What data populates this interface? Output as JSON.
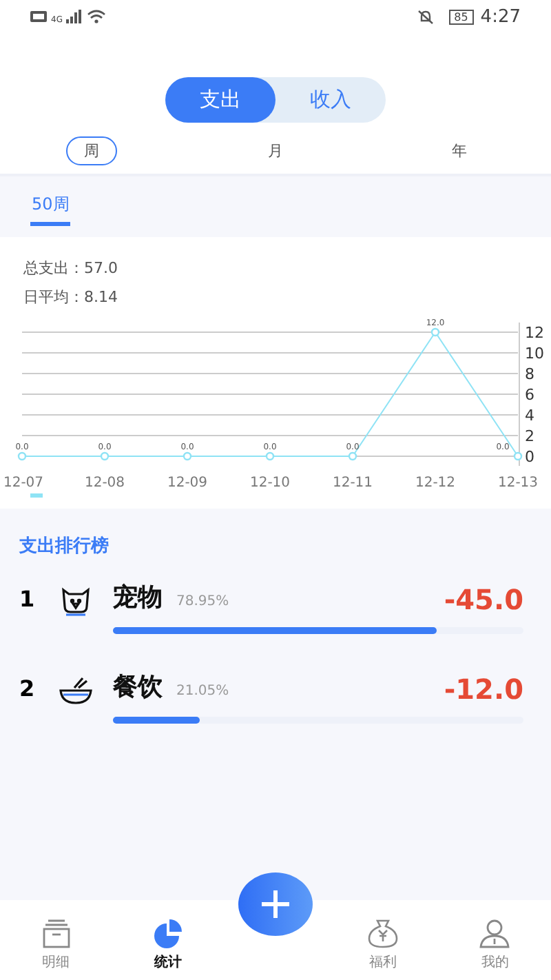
{
  "status_bar": {
    "network": "4G",
    "battery": "85",
    "time": "4:27"
  },
  "type_toggle": [
    {
      "label": "支出",
      "selected": true
    },
    {
      "label": "收入",
      "selected": false
    }
  ],
  "period_tabs": [
    {
      "label": "周",
      "selected": true
    },
    {
      "label": "月",
      "selected": false
    },
    {
      "label": "年",
      "selected": false
    }
  ],
  "week_tabs": [
    {
      "label": "50周",
      "selected": true
    }
  ],
  "summary": [
    {
      "label": "总支出：",
      "value": "57.0"
    },
    {
      "label": "日平均：",
      "value": "8.14"
    }
  ],
  "chart": {
    "chart_data": {
      "type": "line",
      "categories": [
        "12-07",
        "12-08",
        "12-09",
        "12-10",
        "12-11",
        "12-12",
        "12-13"
      ],
      "series": [
        {
          "color": "#8fe3f5",
          "values": [
            0,
            0,
            0,
            0,
            0,
            12,
            0
          ],
          "marker": "circle"
        }
      ],
      "ylim": [
        0,
        12
      ],
      "yticks": [
        0,
        2,
        4,
        6,
        8,
        10,
        12
      ],
      "grid": true,
      "value_labels": [
        "0.0",
        "0.0",
        "0.0",
        "0.0",
        "0.0",
        "12.0",
        "0.0"
      ]
    }
  },
  "ranking": {
    "title": "支出排行榜",
    "items": [
      {
        "rank": "1",
        "kind": "pet",
        "name": "宠物",
        "percent": "78.95%",
        "amount": "-45.0",
        "level": 0.7895
      },
      {
        "rank": "2",
        "kind": "food",
        "name": "餐饮",
        "percent": "21.05%",
        "amount": "-12.0",
        "level": 0.2105
      }
    ]
  },
  "nav": [
    {
      "kind": "details",
      "label": "明细",
      "selected": false
    },
    {
      "kind": "stats",
      "label": "统计",
      "selected": true
    },
    {
      "kind": "add"
    },
    {
      "kind": "welfare",
      "label": "福利",
      "selected": false
    },
    {
      "kind": "me",
      "label": "我的",
      "selected": false
    }
  ]
}
